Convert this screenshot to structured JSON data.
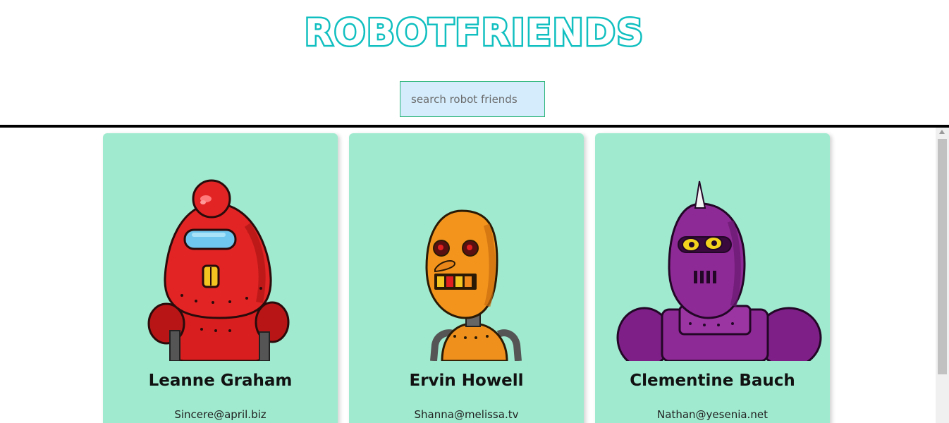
{
  "app": {
    "title": "ROBOTFRIENDS"
  },
  "search": {
    "placeholder": "search robot friends",
    "value": ""
  },
  "robots": [
    {
      "name": "Leanne Graham",
      "email": "Sincere@april.biz",
      "color": "#d81e1e"
    },
    {
      "name": "Ervin Howell",
      "email": "Shanna@melissa.tv",
      "color": "#f0901c"
    },
    {
      "name": "Clementine Bauch",
      "email": "Nathan@yesenia.net",
      "color": "#8e2a95"
    }
  ],
  "colors": {
    "title": "#11bfc0",
    "card_background": "#a0ebd0",
    "search_background": "#d4ecfc"
  }
}
